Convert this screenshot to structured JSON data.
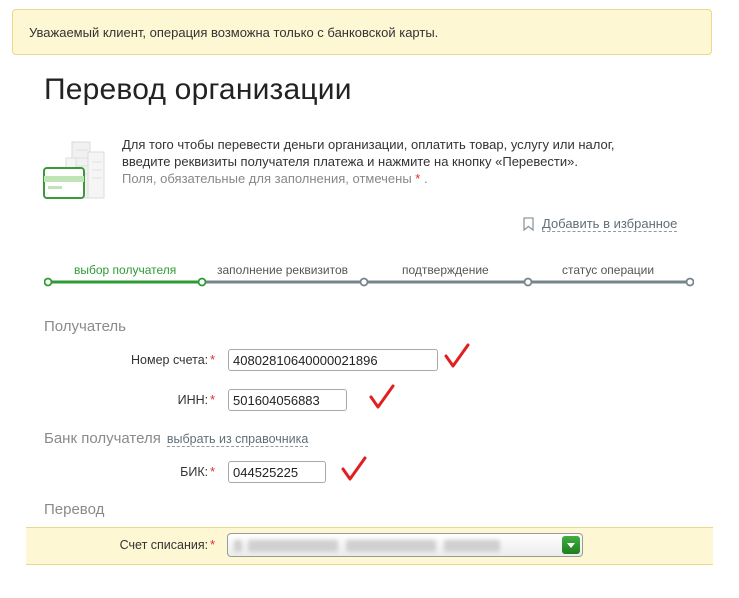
{
  "notice": {
    "text": "Уважаемый клиент, операция возможна только с банковской карты."
  },
  "page": {
    "title": "Перевод организации"
  },
  "intro": {
    "line1": "Для того чтобы перевести деньги организации, оплатить товар, услугу или налог,",
    "line2": "введите реквизиты получателя платежа и нажмите на кнопку «Перевести».",
    "required_note": "Поля, обязательные для заполнения, отмечены",
    "star": "*",
    "end": "."
  },
  "favorites": {
    "label": "Добавить в избранное",
    "icon": "bookmark-icon"
  },
  "steps": [
    {
      "label": "выбор получателя",
      "state": "active"
    },
    {
      "label": "заполнение реквизитов",
      "state": "pending"
    },
    {
      "label": "подтверждение",
      "state": "pending"
    },
    {
      "label": "статус операции",
      "state": "pending"
    }
  ],
  "recipient": {
    "title": "Получатель",
    "account_label": "Номер счета:",
    "account_value": "40802810640000021896",
    "inn_label": "ИНН:",
    "inn_value": "501604056883"
  },
  "bank": {
    "title": "Банк получателя",
    "link": "выбрать из справочника",
    "bik_label": "БИК:",
    "bik_value": "044525225"
  },
  "transfer": {
    "title": "Перевод",
    "account_label": "Счет списания:"
  },
  "colors": {
    "accent_green": "#2f9b35",
    "required_red": "#e32b2b",
    "notice_bg": "#fdf7d4",
    "check_red": "#e02020"
  }
}
